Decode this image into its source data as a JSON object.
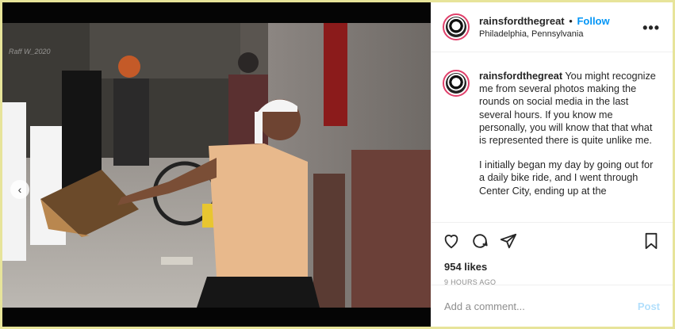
{
  "post": {
    "username": "rainsfordthegreat",
    "separator": "•",
    "follow_label": "Follow",
    "location": "Philadelphia, Pennsylvania",
    "more_label": "•••",
    "caption_username": "rainsfordthegreat",
    "caption_p1": " You might recognize me from several photos making the rounds on social media in the last several hours. If you know me personally, you will know that that what is represented there is quite unlike me.",
    "caption_p2": "I initially began my day by going out for a daily bike ride, and I went through Center City, ending up at the",
    "likes": "954 likes",
    "time": "9 HOURS AGO",
    "comment_placeholder": "Add a comment...",
    "post_label": "Post"
  },
  "photo": {
    "watermark": "Raff W_2020",
    "prev_label": "‹",
    "slides": [
      false,
      true
    ]
  },
  "icons": [
    "heart-icon",
    "comment-icon",
    "share-icon",
    "bookmark-icon",
    "more-icon"
  ]
}
